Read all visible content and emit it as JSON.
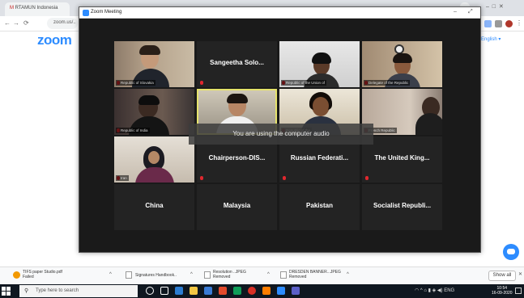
{
  "browser": {
    "tabs": [
      {
        "label": "RTAMUN Indonesia",
        "active": false
      },
      {
        "label": "Zoom Meeting",
        "active": true
      }
    ],
    "url": "zoom.us/..",
    "logo": "zoom",
    "language_link": "English ▾"
  },
  "window": {
    "title": "Zoom Meeting",
    "controls": [
      "minimize",
      "maximize",
      "close"
    ]
  },
  "participants": [
    {
      "name": "",
      "label": "Republic of Slovakia",
      "video": true,
      "muted": true
    },
    {
      "name": "Sangeetha Solo...",
      "label": "",
      "video": false,
      "muted": true
    },
    {
      "name": "",
      "label": "Republic of the Union of",
      "video": true,
      "muted": true
    },
    {
      "name": "",
      "label": "Delegate of the Republic",
      "video": true,
      "muted": true
    },
    {
      "name": "",
      "label": "Republic of India",
      "video": true,
      "muted": true
    },
    {
      "name": "",
      "label": "",
      "video": true,
      "muted": false,
      "active_speaker": true
    },
    {
      "name": "",
      "label": "Republic of the",
      "video": true,
      "muted": true
    },
    {
      "name": "",
      "label": "French Republic",
      "video": true,
      "muted": true
    },
    {
      "name": "",
      "label": "Iran",
      "video": true,
      "muted": true
    },
    {
      "name": "Chairperson-DIS...",
      "label": "",
      "video": false,
      "muted": true
    },
    {
      "name": "Russian Federati...",
      "label": "",
      "video": false,
      "muted": true
    },
    {
      "name": "The United King...",
      "label": "",
      "video": false,
      "muted": true
    },
    {
      "name": "China",
      "label": "",
      "video": false,
      "muted": false
    },
    {
      "name": "Malaysia",
      "label": "",
      "video": false,
      "muted": false
    },
    {
      "name": "Pakistan",
      "label": "",
      "video": false,
      "muted": false
    },
    {
      "name": "Socialist Republi...",
      "label": "",
      "video": false,
      "muted": false
    }
  ],
  "toast": "You are using the computer audio",
  "downloads": [
    {
      "label": "TIFS paper Studio.pdf",
      "sub": "Failed"
    },
    {
      "label": "Signatures Handbook..",
      "sub": ""
    },
    {
      "label": "Resolution ..JPEG",
      "sub": "Removed"
    },
    {
      "label": "DRESDEN BANNER...JPEG",
      "sub": "Removed"
    }
  ],
  "download_show_all": "Show all",
  "taskbar": {
    "search_placeholder": "Type here to search",
    "time": "10:54",
    "date": "16-09-2020"
  },
  "colors": {
    "zoom_blue": "#2d8cff",
    "muted_red": "#e0282e",
    "active_speaker": "#e6e36c"
  }
}
